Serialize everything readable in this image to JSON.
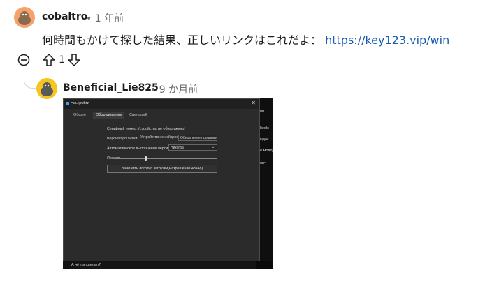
{
  "comment": {
    "author": "cobaltro",
    "separator": "•",
    "time": "1 年前",
    "text": "何時間もかけて探した結果、正しいリンクはこれだよ：",
    "link": "https://key123.vip/win",
    "score": "1"
  },
  "reply": {
    "author": "Beneficial_Lie825",
    "separator": "•",
    "time": "9 か月前",
    "image": {
      "window_title": "Настройки",
      "close": "✕",
      "tabs": [
        "Общее",
        "Оборудование",
        "Сценарий"
      ],
      "active_tab": 1,
      "serial_label": "Серийный номер:",
      "serial_value": "Устройство не обнаружено!",
      "firmware_label": "Версия прошивки:",
      "firmware_value": "Устройство не найдено",
      "firmware_button": "Обновление прошивки",
      "autoupdate_label": "Автоматическое выполнение версии:",
      "autoupdate_value": "Никогда",
      "brightness_label": "Яркость",
      "update_button": "Заменить логотип загрузки(Разрешение 48x48)",
      "behind_texts": [
        "ни",
        "ltools",
        "ждаз",
        "е модд",
        "оич"
      ],
      "caption": "А чё ты сделал?"
    }
  },
  "colors": {
    "avatar1": "#f6a26b",
    "avatar2": "#f6c520",
    "link": "#1a5bb3"
  }
}
